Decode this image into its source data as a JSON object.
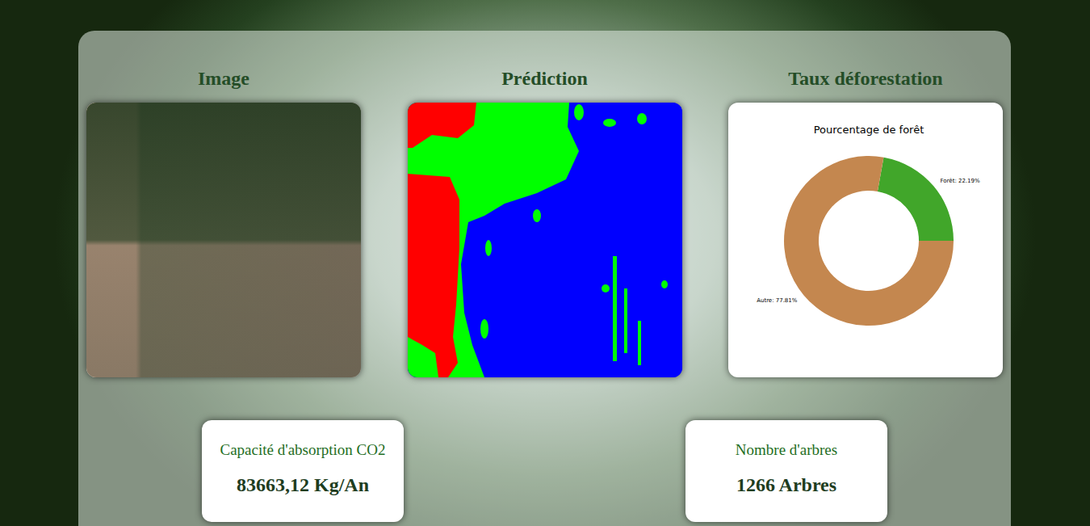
{
  "image": {
    "title": "Image"
  },
  "prediction": {
    "title": "Prédiction"
  },
  "deforestation": {
    "title": "Taux déforestation",
    "chart": {
      "title": "Pourcentage de forêt",
      "series": [
        {
          "label": "Forêt: 22.19%",
          "value": 22.19,
          "color": "#41a62a"
        },
        {
          "label": "Autre: 77.81%",
          "value": 77.81,
          "color": "#c4874f"
        }
      ]
    }
  },
  "stats": [
    {
      "label": "Capacité d'absorption CO2",
      "value": "83663,12 Kg/An"
    },
    {
      "label": "Nombre d'arbres",
      "value": "1266 Arbres"
    }
  ]
}
